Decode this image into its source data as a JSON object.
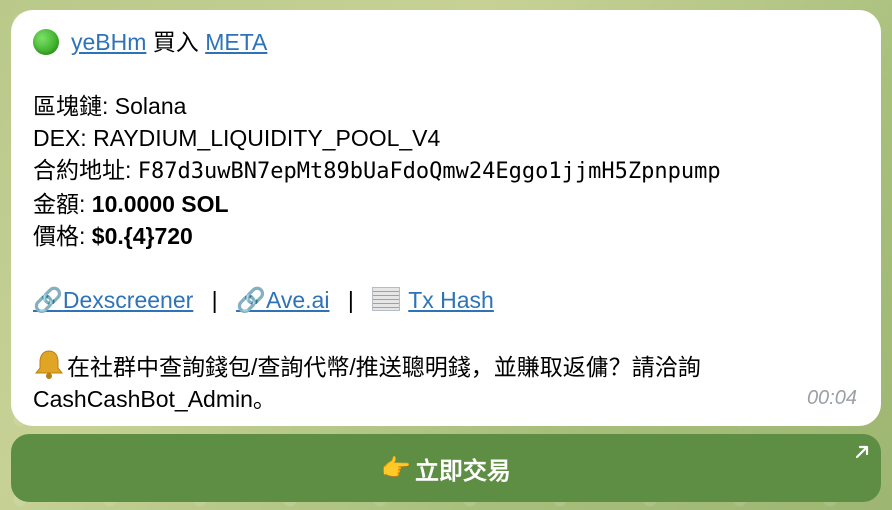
{
  "message": {
    "user": "yeBHm",
    "action": "買入",
    "token": "META",
    "chain_label": "區塊鏈: ",
    "chain_value": "Solana",
    "dex_label": "DEX: ",
    "dex_value": "RAYDIUM_LIQUIDITY_POOL_V4",
    "contract_label": "合約地址: ",
    "contract_value": "F87d3uwBN7epMt89bUaFdoQmw24Eggo1jjmH5Zpnpump",
    "amount_label": "金額: ",
    "amount_value": "10.0000 SOL",
    "price_label": "價格: ",
    "price_value": "$0.{4}720",
    "links": {
      "dexscreener": "Dexscreener",
      "ave": "Ave.ai",
      "txhash": "Tx Hash",
      "separator": "|"
    },
    "promo_line1": "在社群中查詢錢包/查詢代幣/推送聰明錢，並賺取返傭？請洽詢",
    "promo_line2": "CashCashBot_Admin。",
    "time": "00:04"
  },
  "button": {
    "label": "立即交易"
  },
  "icons": {
    "status_dot": "green-circle-icon",
    "link": "link-icon",
    "receipt": "receipt-icon",
    "bell": "bell-icon",
    "hand": "pointing-hand-icon",
    "external": "arrow-up-right-icon"
  }
}
